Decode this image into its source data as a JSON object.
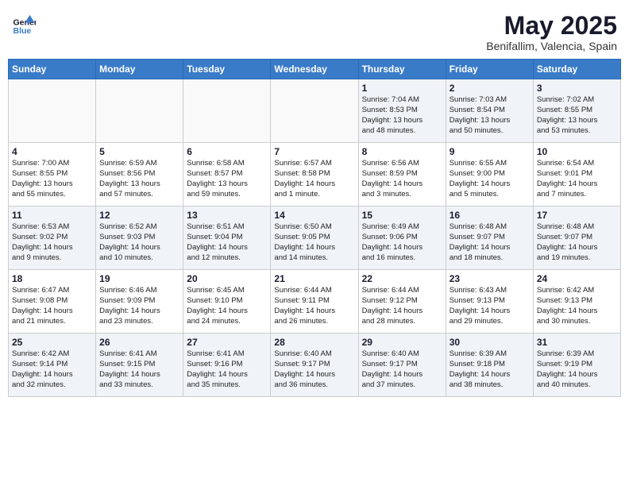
{
  "logo": {
    "line1": "General",
    "line2": "Blue"
  },
  "title": "May 2025",
  "subtitle": "Benifallim, Valencia, Spain",
  "weekdays": [
    "Sunday",
    "Monday",
    "Tuesday",
    "Wednesday",
    "Thursday",
    "Friday",
    "Saturday"
  ],
  "weeks": [
    [
      {
        "day": "",
        "info": ""
      },
      {
        "day": "",
        "info": ""
      },
      {
        "day": "",
        "info": ""
      },
      {
        "day": "",
        "info": ""
      },
      {
        "day": "1",
        "info": "Sunrise: 7:04 AM\nSunset: 8:53 PM\nDaylight: 13 hours\nand 48 minutes."
      },
      {
        "day": "2",
        "info": "Sunrise: 7:03 AM\nSunset: 8:54 PM\nDaylight: 13 hours\nand 50 minutes."
      },
      {
        "day": "3",
        "info": "Sunrise: 7:02 AM\nSunset: 8:55 PM\nDaylight: 13 hours\nand 53 minutes."
      }
    ],
    [
      {
        "day": "4",
        "info": "Sunrise: 7:00 AM\nSunset: 8:55 PM\nDaylight: 13 hours\nand 55 minutes."
      },
      {
        "day": "5",
        "info": "Sunrise: 6:59 AM\nSunset: 8:56 PM\nDaylight: 13 hours\nand 57 minutes."
      },
      {
        "day": "6",
        "info": "Sunrise: 6:58 AM\nSunset: 8:57 PM\nDaylight: 13 hours\nand 59 minutes."
      },
      {
        "day": "7",
        "info": "Sunrise: 6:57 AM\nSunset: 8:58 PM\nDaylight: 14 hours\nand 1 minute."
      },
      {
        "day": "8",
        "info": "Sunrise: 6:56 AM\nSunset: 8:59 PM\nDaylight: 14 hours\nand 3 minutes."
      },
      {
        "day": "9",
        "info": "Sunrise: 6:55 AM\nSunset: 9:00 PM\nDaylight: 14 hours\nand 5 minutes."
      },
      {
        "day": "10",
        "info": "Sunrise: 6:54 AM\nSunset: 9:01 PM\nDaylight: 14 hours\nand 7 minutes."
      }
    ],
    [
      {
        "day": "11",
        "info": "Sunrise: 6:53 AM\nSunset: 9:02 PM\nDaylight: 14 hours\nand 9 minutes."
      },
      {
        "day": "12",
        "info": "Sunrise: 6:52 AM\nSunset: 9:03 PM\nDaylight: 14 hours\nand 10 minutes."
      },
      {
        "day": "13",
        "info": "Sunrise: 6:51 AM\nSunset: 9:04 PM\nDaylight: 14 hours\nand 12 minutes."
      },
      {
        "day": "14",
        "info": "Sunrise: 6:50 AM\nSunset: 9:05 PM\nDaylight: 14 hours\nand 14 minutes."
      },
      {
        "day": "15",
        "info": "Sunrise: 6:49 AM\nSunset: 9:06 PM\nDaylight: 14 hours\nand 16 minutes."
      },
      {
        "day": "16",
        "info": "Sunrise: 6:48 AM\nSunset: 9:07 PM\nDaylight: 14 hours\nand 18 minutes."
      },
      {
        "day": "17",
        "info": "Sunrise: 6:48 AM\nSunset: 9:07 PM\nDaylight: 14 hours\nand 19 minutes."
      }
    ],
    [
      {
        "day": "18",
        "info": "Sunrise: 6:47 AM\nSunset: 9:08 PM\nDaylight: 14 hours\nand 21 minutes."
      },
      {
        "day": "19",
        "info": "Sunrise: 6:46 AM\nSunset: 9:09 PM\nDaylight: 14 hours\nand 23 minutes."
      },
      {
        "day": "20",
        "info": "Sunrise: 6:45 AM\nSunset: 9:10 PM\nDaylight: 14 hours\nand 24 minutes."
      },
      {
        "day": "21",
        "info": "Sunrise: 6:44 AM\nSunset: 9:11 PM\nDaylight: 14 hours\nand 26 minutes."
      },
      {
        "day": "22",
        "info": "Sunrise: 6:44 AM\nSunset: 9:12 PM\nDaylight: 14 hours\nand 28 minutes."
      },
      {
        "day": "23",
        "info": "Sunrise: 6:43 AM\nSunset: 9:13 PM\nDaylight: 14 hours\nand 29 minutes."
      },
      {
        "day": "24",
        "info": "Sunrise: 6:42 AM\nSunset: 9:13 PM\nDaylight: 14 hours\nand 30 minutes."
      }
    ],
    [
      {
        "day": "25",
        "info": "Sunrise: 6:42 AM\nSunset: 9:14 PM\nDaylight: 14 hours\nand 32 minutes."
      },
      {
        "day": "26",
        "info": "Sunrise: 6:41 AM\nSunset: 9:15 PM\nDaylight: 14 hours\nand 33 minutes."
      },
      {
        "day": "27",
        "info": "Sunrise: 6:41 AM\nSunset: 9:16 PM\nDaylight: 14 hours\nand 35 minutes."
      },
      {
        "day": "28",
        "info": "Sunrise: 6:40 AM\nSunset: 9:17 PM\nDaylight: 14 hours\nand 36 minutes."
      },
      {
        "day": "29",
        "info": "Sunrise: 6:40 AM\nSunset: 9:17 PM\nDaylight: 14 hours\nand 37 minutes."
      },
      {
        "day": "30",
        "info": "Sunrise: 6:39 AM\nSunset: 9:18 PM\nDaylight: 14 hours\nand 38 minutes."
      },
      {
        "day": "31",
        "info": "Sunrise: 6:39 AM\nSunset: 9:19 PM\nDaylight: 14 hours\nand 40 minutes."
      }
    ]
  ]
}
